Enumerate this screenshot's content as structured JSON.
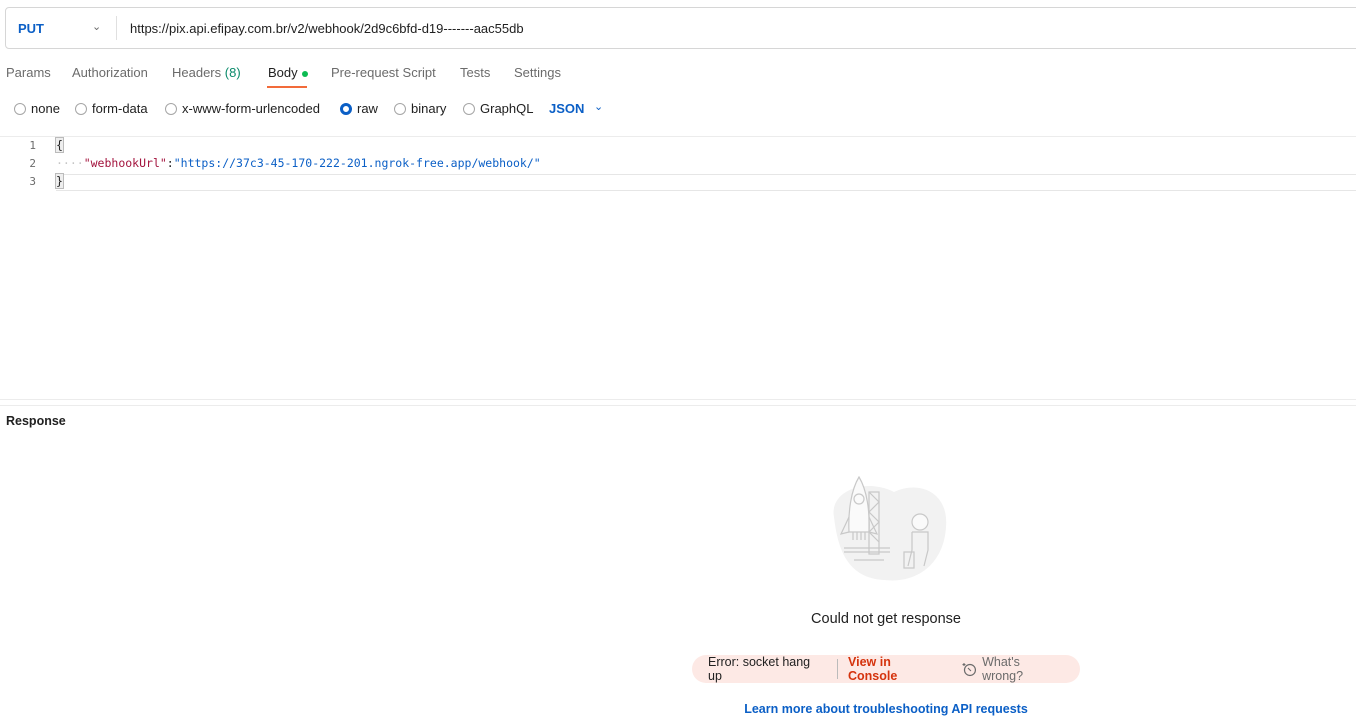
{
  "request": {
    "method": "PUT",
    "url": "https://pix.api.efipay.com.br/v2/webhook/2d9c6bfd-d19-------aac55db"
  },
  "tabs": [
    {
      "label": "Params"
    },
    {
      "label": "Authorization"
    },
    {
      "label": "Headers",
      "count": "(8)"
    },
    {
      "label": "Body"
    },
    {
      "label": "Pre-request Script"
    },
    {
      "label": "Tests"
    },
    {
      "label": "Settings"
    }
  ],
  "body_types": [
    {
      "label": "none"
    },
    {
      "label": "form-data"
    },
    {
      "label": "x-www-form-urlencoded"
    },
    {
      "label": "raw",
      "selected": true
    },
    {
      "label": "binary"
    },
    {
      "label": "GraphQL"
    }
  ],
  "format": "JSON",
  "editor": {
    "line_numbers": [
      "1",
      "2",
      "3"
    ],
    "open_brace": "{",
    "key": "\"webhookUrl\"",
    "colon": ":",
    "value": "\"https://37c3-45-170-222-201.ngrok-free.app/webhook/\"",
    "close_brace": "}",
    "indent": "····"
  },
  "response": {
    "title": "Response",
    "message": "Could not get response",
    "error": "Error: socket hang up",
    "view_console": "View in Console",
    "whats_wrong": "What's wrong?",
    "learn_more": "Learn more about troubleshooting API requests"
  },
  "colors": {
    "accent": "#0b5fc6",
    "tab_underline": "#f26b3a",
    "dot": "#0cbb52",
    "error": "#d5330d",
    "pill_bg": "#fde9e5"
  }
}
